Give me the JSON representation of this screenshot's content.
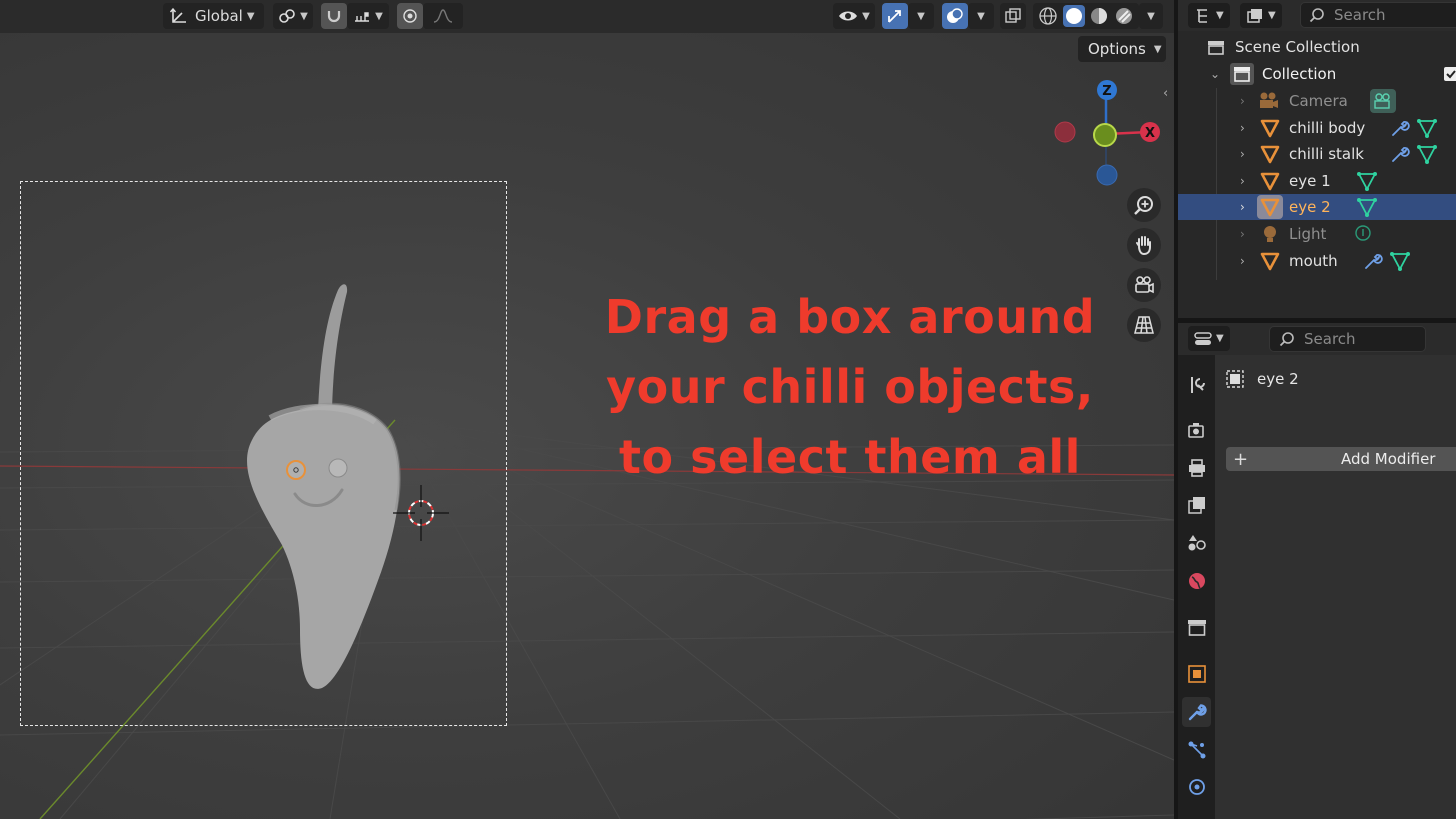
{
  "viewport": {
    "transform_orientation": "Global",
    "options_label": "Options",
    "gizmo": {
      "z_label": "Z",
      "x_label": "X"
    },
    "instruction_lines": [
      "Drag a box around",
      "your chilli objects,",
      "to select them all"
    ]
  },
  "outliner": {
    "search_placeholder": "Search",
    "scene_collection": "Scene Collection",
    "collection": "Collection",
    "items": [
      {
        "label": "Camera",
        "type": "camera",
        "dim": true,
        "selected": false
      },
      {
        "label": "chilli body",
        "type": "mesh",
        "dim": false,
        "selected": false,
        "modifier": true
      },
      {
        "label": "chilli stalk",
        "type": "mesh",
        "dim": false,
        "selected": false,
        "modifier": true
      },
      {
        "label": "eye 1",
        "type": "mesh",
        "dim": false,
        "selected": false,
        "modifier": false
      },
      {
        "label": "eye 2",
        "type": "mesh",
        "dim": false,
        "selected": true,
        "modifier": false
      },
      {
        "label": "Light",
        "type": "light",
        "dim": true,
        "selected": false
      },
      {
        "label": "mouth",
        "type": "mesh",
        "dim": false,
        "selected": false,
        "modifier": true
      }
    ]
  },
  "properties": {
    "search_placeholder": "Search",
    "object_name": "eye 2",
    "add_modifier_label": "Add Modifier"
  },
  "colors": {
    "accent": "#4772b3",
    "instruction_text": "#ef3b2c",
    "mesh_icon": "#e8913a",
    "selected_row": "#334d80",
    "selected_text": "#ffb45a"
  }
}
